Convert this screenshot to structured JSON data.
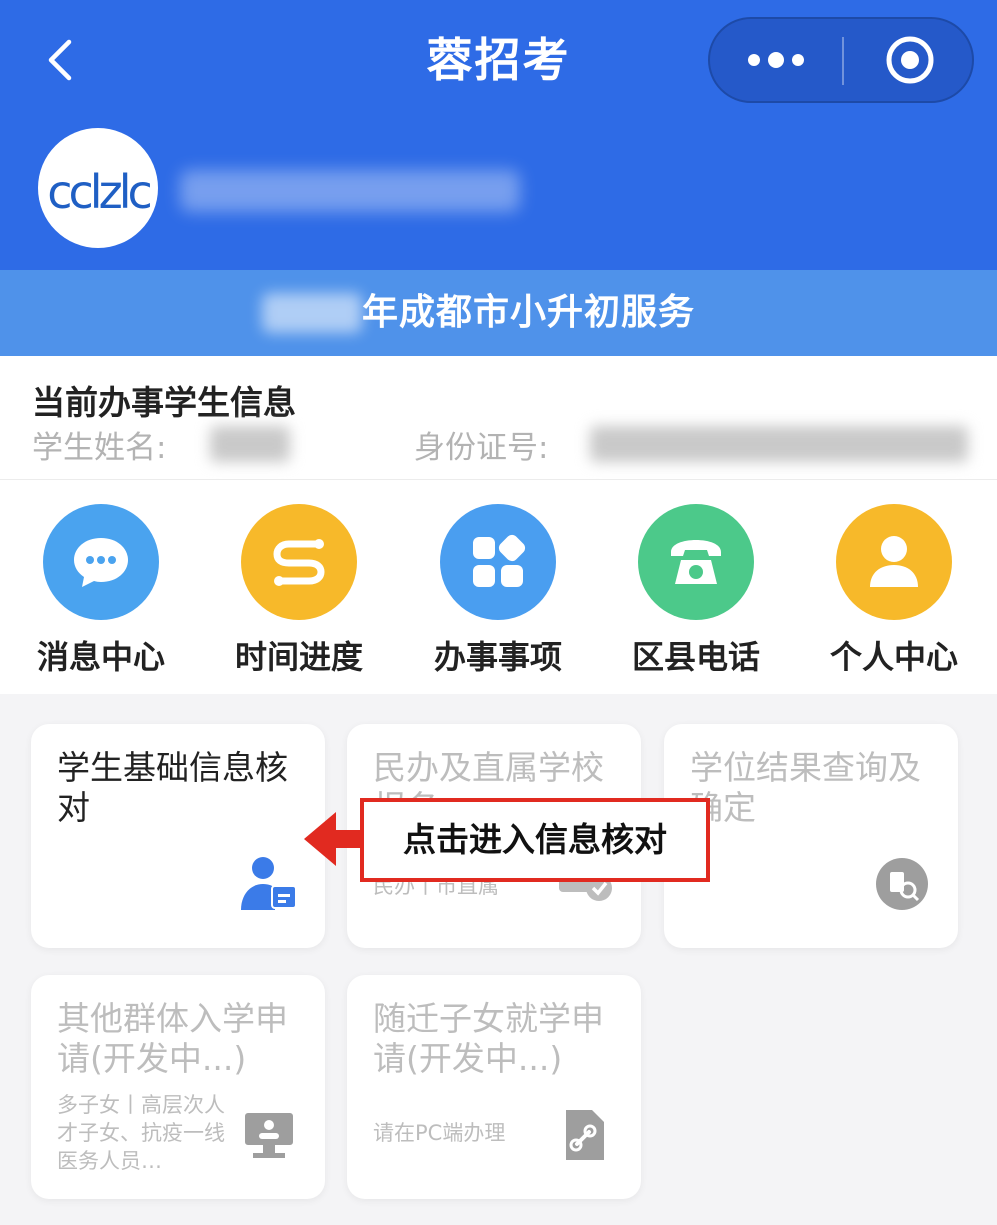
{
  "header": {
    "title": "蓉招考",
    "logo_text": "cclzlc"
  },
  "banner": {
    "text": "年成都市小升初服务"
  },
  "student_info": {
    "title": "当前办事学生信息",
    "name_label": "学生姓名:",
    "id_label": "身份证号:"
  },
  "nav": {
    "items": [
      {
        "label": "消息中心",
        "icon": "chat-bubble-icon",
        "color": "#4aa3ef"
      },
      {
        "label": "时间进度",
        "icon": "timeline-icon",
        "color": "#f7b92a"
      },
      {
        "label": "办事事项",
        "icon": "grid-apps-icon",
        "color": "#4a9ef0"
      },
      {
        "label": "区县电话",
        "icon": "telephone-icon",
        "color": "#4cc98a"
      },
      {
        "label": "个人中心",
        "icon": "person-icon",
        "color": "#f7b92a"
      }
    ]
  },
  "cards": [
    {
      "title": "学生基础信息核对",
      "sub": "",
      "icon": "user-id-icon"
    },
    {
      "title": "民办及直属学校报名",
      "sub": "民办丨市直属",
      "icon": "bus-check-icon"
    },
    {
      "title": "学位结果查询及确定",
      "sub": "",
      "icon": "result-search-icon"
    },
    {
      "title": "其他群体入学申请(开发中...)",
      "sub": "多子女丨高层次人才子女、抗疫一线医务人员…",
      "icon": "monitor-icon"
    },
    {
      "title": "随迁子女就学申请(开发中...)",
      "sub": "请在PC端办理",
      "icon": "document-link-icon"
    }
  ],
  "annotation": {
    "text": "点击进入信息核对",
    "color": "#e12a20"
  },
  "colors": {
    "header_bg": "#2e6be6",
    "banner_bg": "#4f92ea",
    "active_icon": "#3b7be8"
  }
}
